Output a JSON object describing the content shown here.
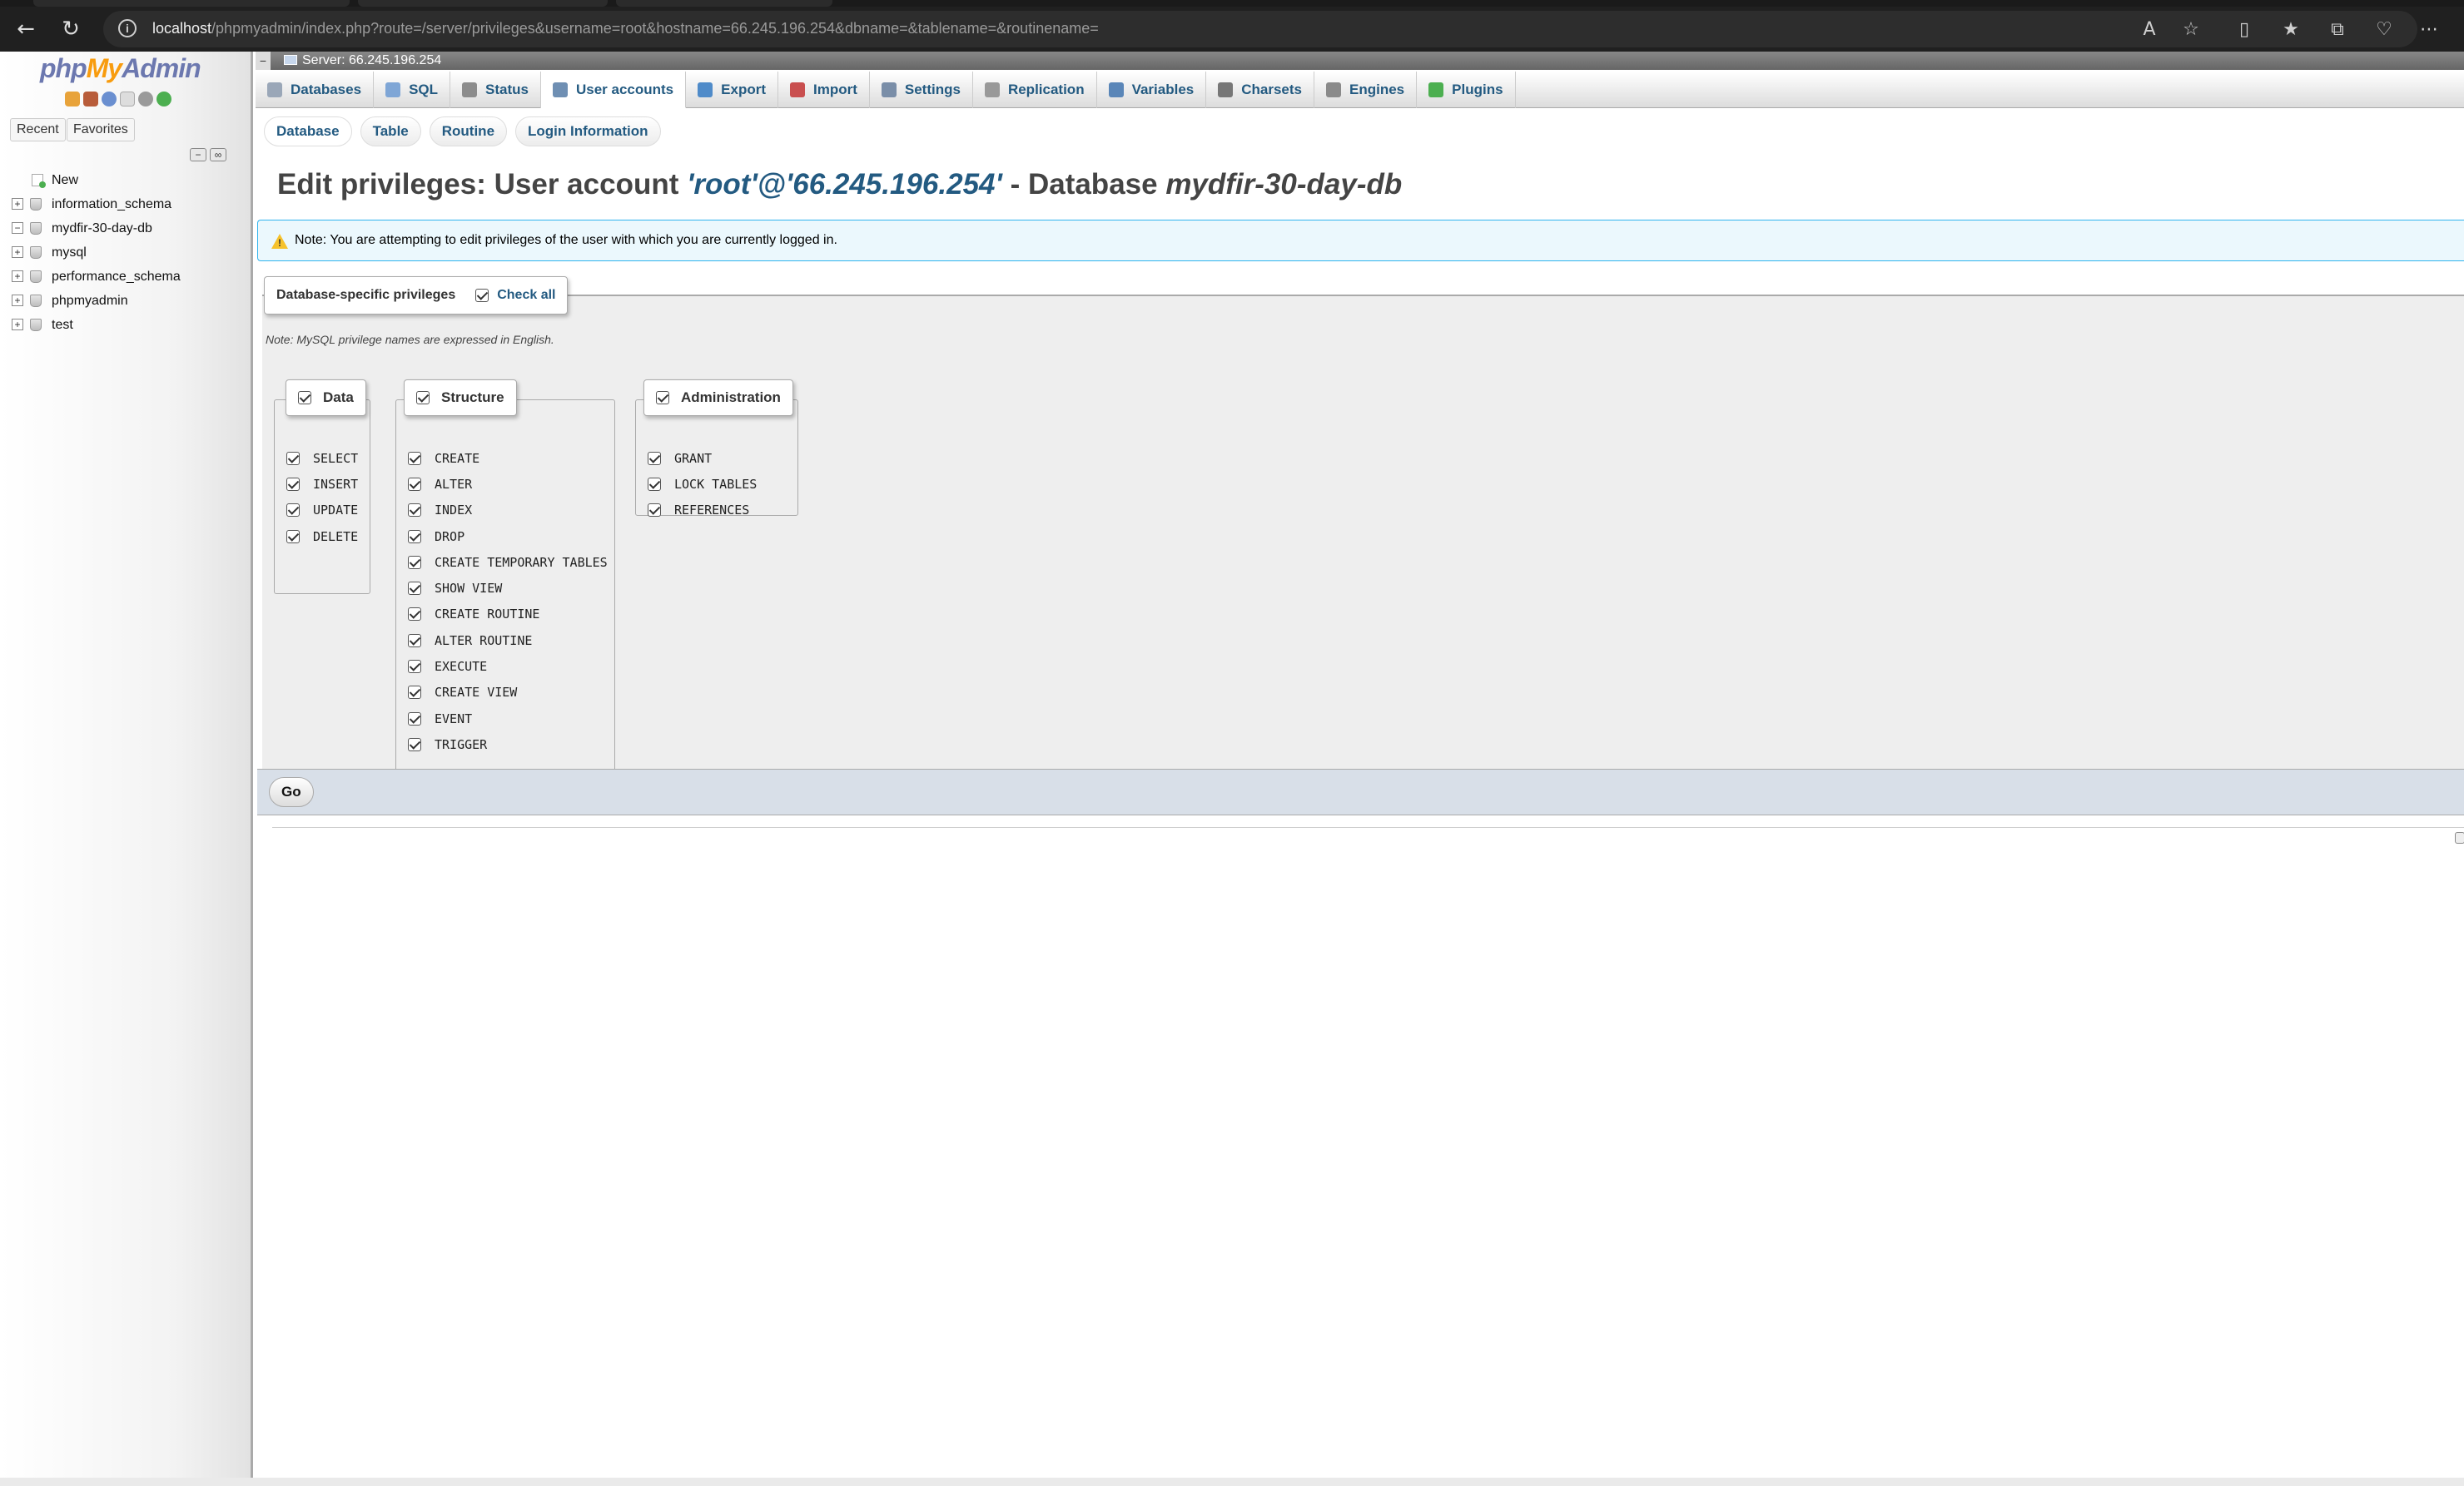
{
  "browser": {
    "url_host": "localhost",
    "url_path": "/phpmyadmin/index.php?route=/server/privileges&username=root&hostname=66.245.196.254&dbname=&tablename=&routinename="
  },
  "nav": {
    "logo_php": "php",
    "logo_my": "My",
    "logo_admin": "Admin",
    "recent": "Recent",
    "favorites": "Favorites",
    "tree": [
      "New",
      "information_schema",
      "mydfir-30-day-db",
      "mysql",
      "performance_schema",
      "phpmyadmin",
      "test"
    ]
  },
  "server": {
    "label": "Server: 66.245.196.254"
  },
  "topmenu": [
    {
      "label": "Databases",
      "color": "#9aa7b8"
    },
    {
      "label": "SQL",
      "color": "#7fa6d6"
    },
    {
      "label": "Status",
      "color": "#8c8c8c"
    },
    {
      "label": "User accounts",
      "color": "#6f8fb3"
    },
    {
      "label": "Export",
      "color": "#4f8bc9"
    },
    {
      "label": "Import",
      "color": "#c94f4f"
    },
    {
      "label": "Settings",
      "color": "#7a8ea8"
    },
    {
      "label": "Replication",
      "color": "#999999"
    },
    {
      "label": "Variables",
      "color": "#5a86b8"
    },
    {
      "label": "Charsets",
      "color": "#777777"
    },
    {
      "label": "Engines",
      "color": "#8a8a8a"
    },
    {
      "label": "Plugins",
      "color": "#4caf50"
    }
  ],
  "subtabs": [
    "Database",
    "Table",
    "Routine",
    "Login Information"
  ],
  "heading": {
    "prefix": "Edit privileges: User account ",
    "user": "'root'@'66.245.196.254'",
    "mid": " - Database ",
    "db": "mydfir-30-day-db"
  },
  "notice": "Note: You are attempting to edit privileges of the user with which you are currently logged in.",
  "privileges": {
    "legend": "Database-specific privileges",
    "check_all": "Check all",
    "note": "Note: MySQL privilege names are expressed in English.",
    "groups": {
      "data": {
        "title": "Data",
        "items": [
          "SELECT",
          "INSERT",
          "UPDATE",
          "DELETE"
        ]
      },
      "structure": {
        "title": "Structure",
        "items": [
          "CREATE",
          "ALTER",
          "INDEX",
          "DROP",
          "CREATE TEMPORARY TABLES",
          "SHOW VIEW",
          "CREATE ROUTINE",
          "ALTER ROUTINE",
          "EXECUTE",
          "CREATE VIEW",
          "EVENT",
          "TRIGGER"
        ]
      },
      "administration": {
        "title": "Administration",
        "items": [
          "GRANT",
          "LOCK TABLES",
          "REFERENCES"
        ]
      }
    }
  },
  "go_label": "Go"
}
